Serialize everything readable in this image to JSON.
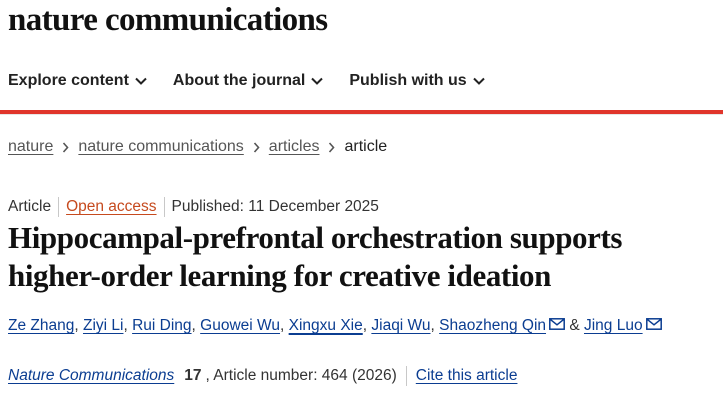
{
  "site": {
    "brand": "nature communications"
  },
  "nav": {
    "items": [
      "Explore content",
      "About the journal",
      "Publish with us"
    ]
  },
  "breadcrumb": {
    "items": [
      "nature",
      "nature communications",
      "articles"
    ],
    "current": "article"
  },
  "article": {
    "type": "Article",
    "access": "Open access",
    "published": "Published: 11 December 2025",
    "title": "Hippocampal-prefrontal orchestration supports higher-order learning for creative ideation",
    "authors": [
      "Ze Zhang",
      "Ziyi Li",
      "Rui Ding",
      "Guowei Wu",
      "Xingxu Xie",
      "Jiaqi Wu",
      "Shaozheng Qin",
      "Jing Luo"
    ],
    "author_separator": ",",
    "author_and": "&",
    "journal": "Nature Communications",
    "volume": "17",
    "article_number": ", Article number: 464 (2026)",
    "cite_label": "Cite this article"
  },
  "colors": {
    "accent_bar": "#e0352b",
    "link": "#0b3d91",
    "open_access": "#c64a1e"
  },
  "icons": {
    "nav_chevron": "chevron-down-icon",
    "breadcrumb_separator": "chevron-right-icon",
    "corresponding_author": "email-icon"
  }
}
